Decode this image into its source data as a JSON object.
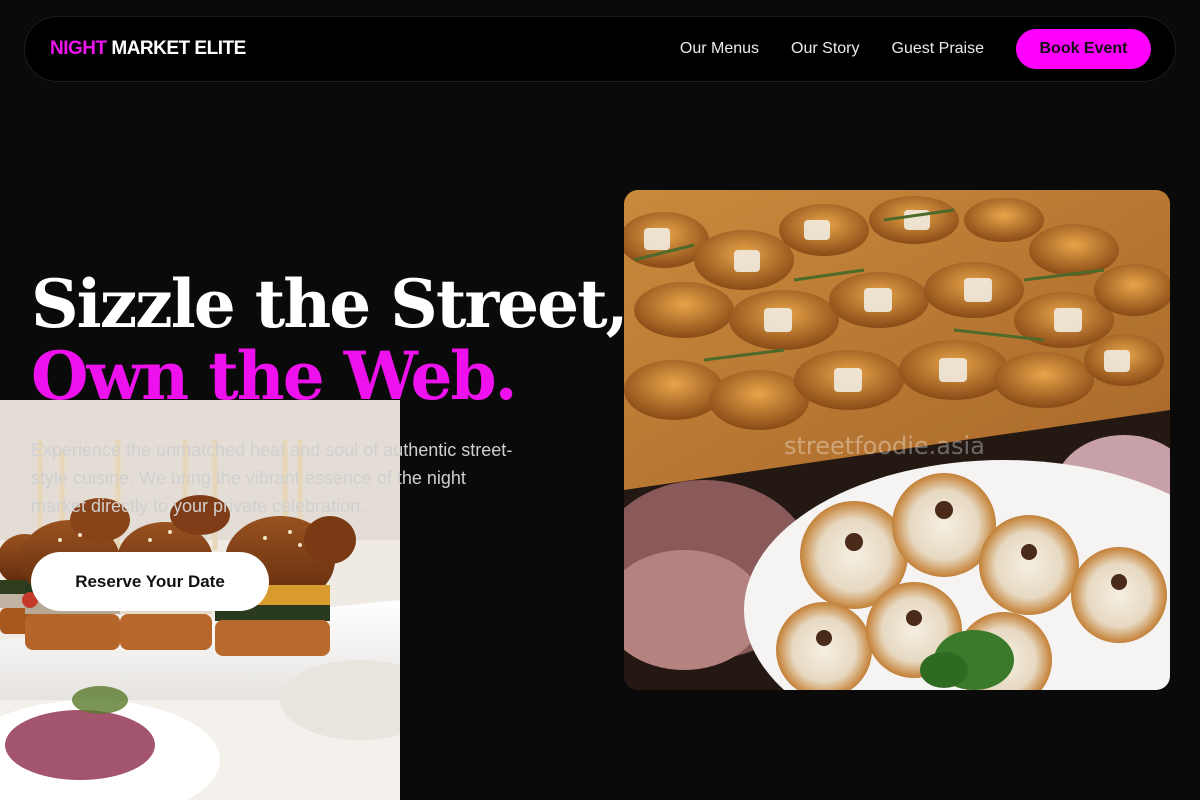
{
  "nav": {
    "brand_accent": "NIGHT",
    "brand_rest": " MARKET ELITE",
    "links": [
      "Our Menus",
      "Our Story",
      "Guest Praise"
    ],
    "cta": "Book Event"
  },
  "hero": {
    "title_line1": "Sizzle the Street,",
    "title_line2": "Own the Web.",
    "description": "Experience the unmatched heat and soul of authentic street-style cuisine. We bring the vibrant essence of the night market directly to your private celebration.",
    "cta": "Reserve Your Date"
  },
  "images": {
    "left_food": "sliders-icon",
    "right_food": "pastries-icon",
    "watermark": "streetfoodie.asia"
  },
  "colors": {
    "accent": "#ff00ff",
    "background": "#0a0a0a",
    "nav_bg": "#000000"
  }
}
